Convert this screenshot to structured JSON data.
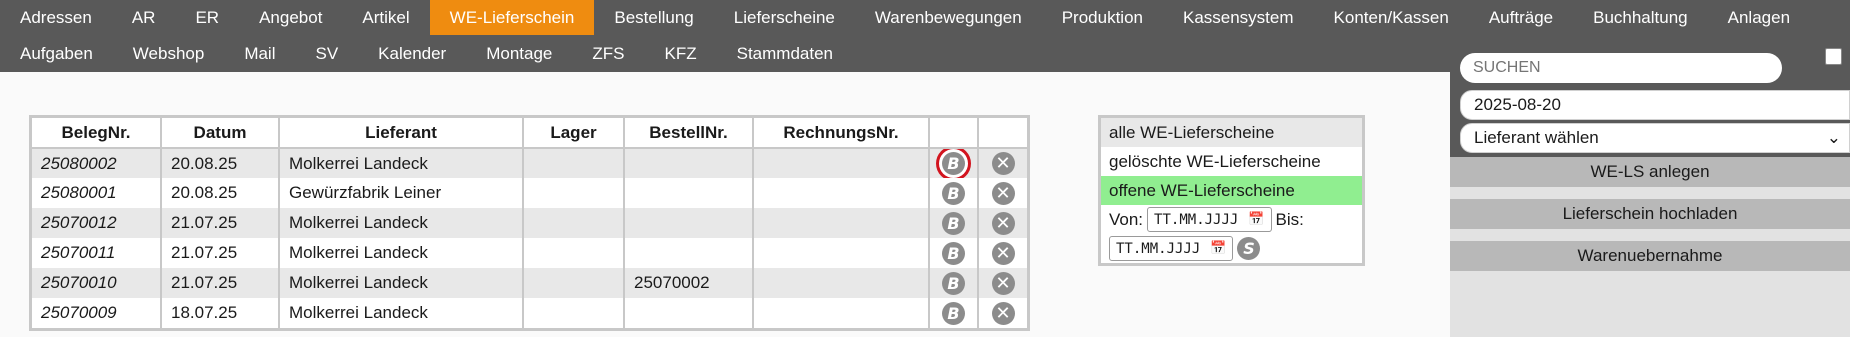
{
  "nav": {
    "row1": [
      "Adressen",
      "AR",
      "ER",
      "Angebot",
      "Artikel",
      "WE-Lieferschein",
      "Bestellung",
      "Lieferscheine",
      "Warenbewegungen",
      "Produktion",
      "Kassensystem",
      "Konten/Kassen",
      "Aufträge",
      "Buchhaltung",
      "Anlagen"
    ],
    "row2": [
      "Aufgaben",
      "Webshop",
      "Mail",
      "SV",
      "Kalender",
      "Montage",
      "ZFS",
      "KFZ",
      "Stammdaten"
    ],
    "active": "WE-Lieferschein"
  },
  "table": {
    "headers": [
      "BelegNr.",
      "Datum",
      "Lieferant",
      "Lager",
      "BestellNr.",
      "RechnungsNr.",
      "",
      ""
    ],
    "rows": [
      {
        "belegnr": "25080002",
        "datum": "20.08.25",
        "lieferant": "Molkerrei Landeck",
        "lager": "",
        "bestellnr": "",
        "rechnungsnr": ""
      },
      {
        "belegnr": "25080001",
        "datum": "20.08.25",
        "lieferant": "Gewürzfabrik Leiner",
        "lager": "",
        "bestellnr": "",
        "rechnungsnr": ""
      },
      {
        "belegnr": "25070012",
        "datum": "21.07.25",
        "lieferant": "Molkerrei Landeck",
        "lager": "",
        "bestellnr": "",
        "rechnungsnr": ""
      },
      {
        "belegnr": "25070011",
        "datum": "21.07.25",
        "lieferant": "Molkerrei Landeck",
        "lager": "",
        "bestellnr": "",
        "rechnungsnr": ""
      },
      {
        "belegnr": "25070010",
        "datum": "21.07.25",
        "lieferant": "Molkerrei Landeck",
        "lager": "",
        "bestellnr": "25070002",
        "rechnungsnr": ""
      },
      {
        "belegnr": "25070009",
        "datum": "18.07.25",
        "lieferant": "Molkerrei Landeck",
        "lager": "",
        "bestellnr": "",
        "rechnungsnr": ""
      }
    ],
    "book_icon_label": "B",
    "delete_icon_label": "✕"
  },
  "filter": {
    "all": "alle WE-Lieferscheine",
    "deleted": "gelöschte WE-Lieferscheine",
    "open": "offene WE-Lieferscheine",
    "from_label": "Von:",
    "to_label": "Bis:",
    "date_placeholder": "TT.MM.JJJJ",
    "search_icon_label": "S"
  },
  "side": {
    "search_placeholder": "SUCHEN",
    "date_value": "2025-08-20",
    "supplier_select": "Lieferant wählen",
    "btn_create": "WE-LS anlegen",
    "btn_upload": "Lieferschein hochladen",
    "btn_receipt": "Warenuebernahme"
  },
  "colors": {
    "nav_bg": "#595959",
    "active_tab": "#ef8c10",
    "filter_active": "#90ee90",
    "highlight_ring": "#d2141e"
  }
}
